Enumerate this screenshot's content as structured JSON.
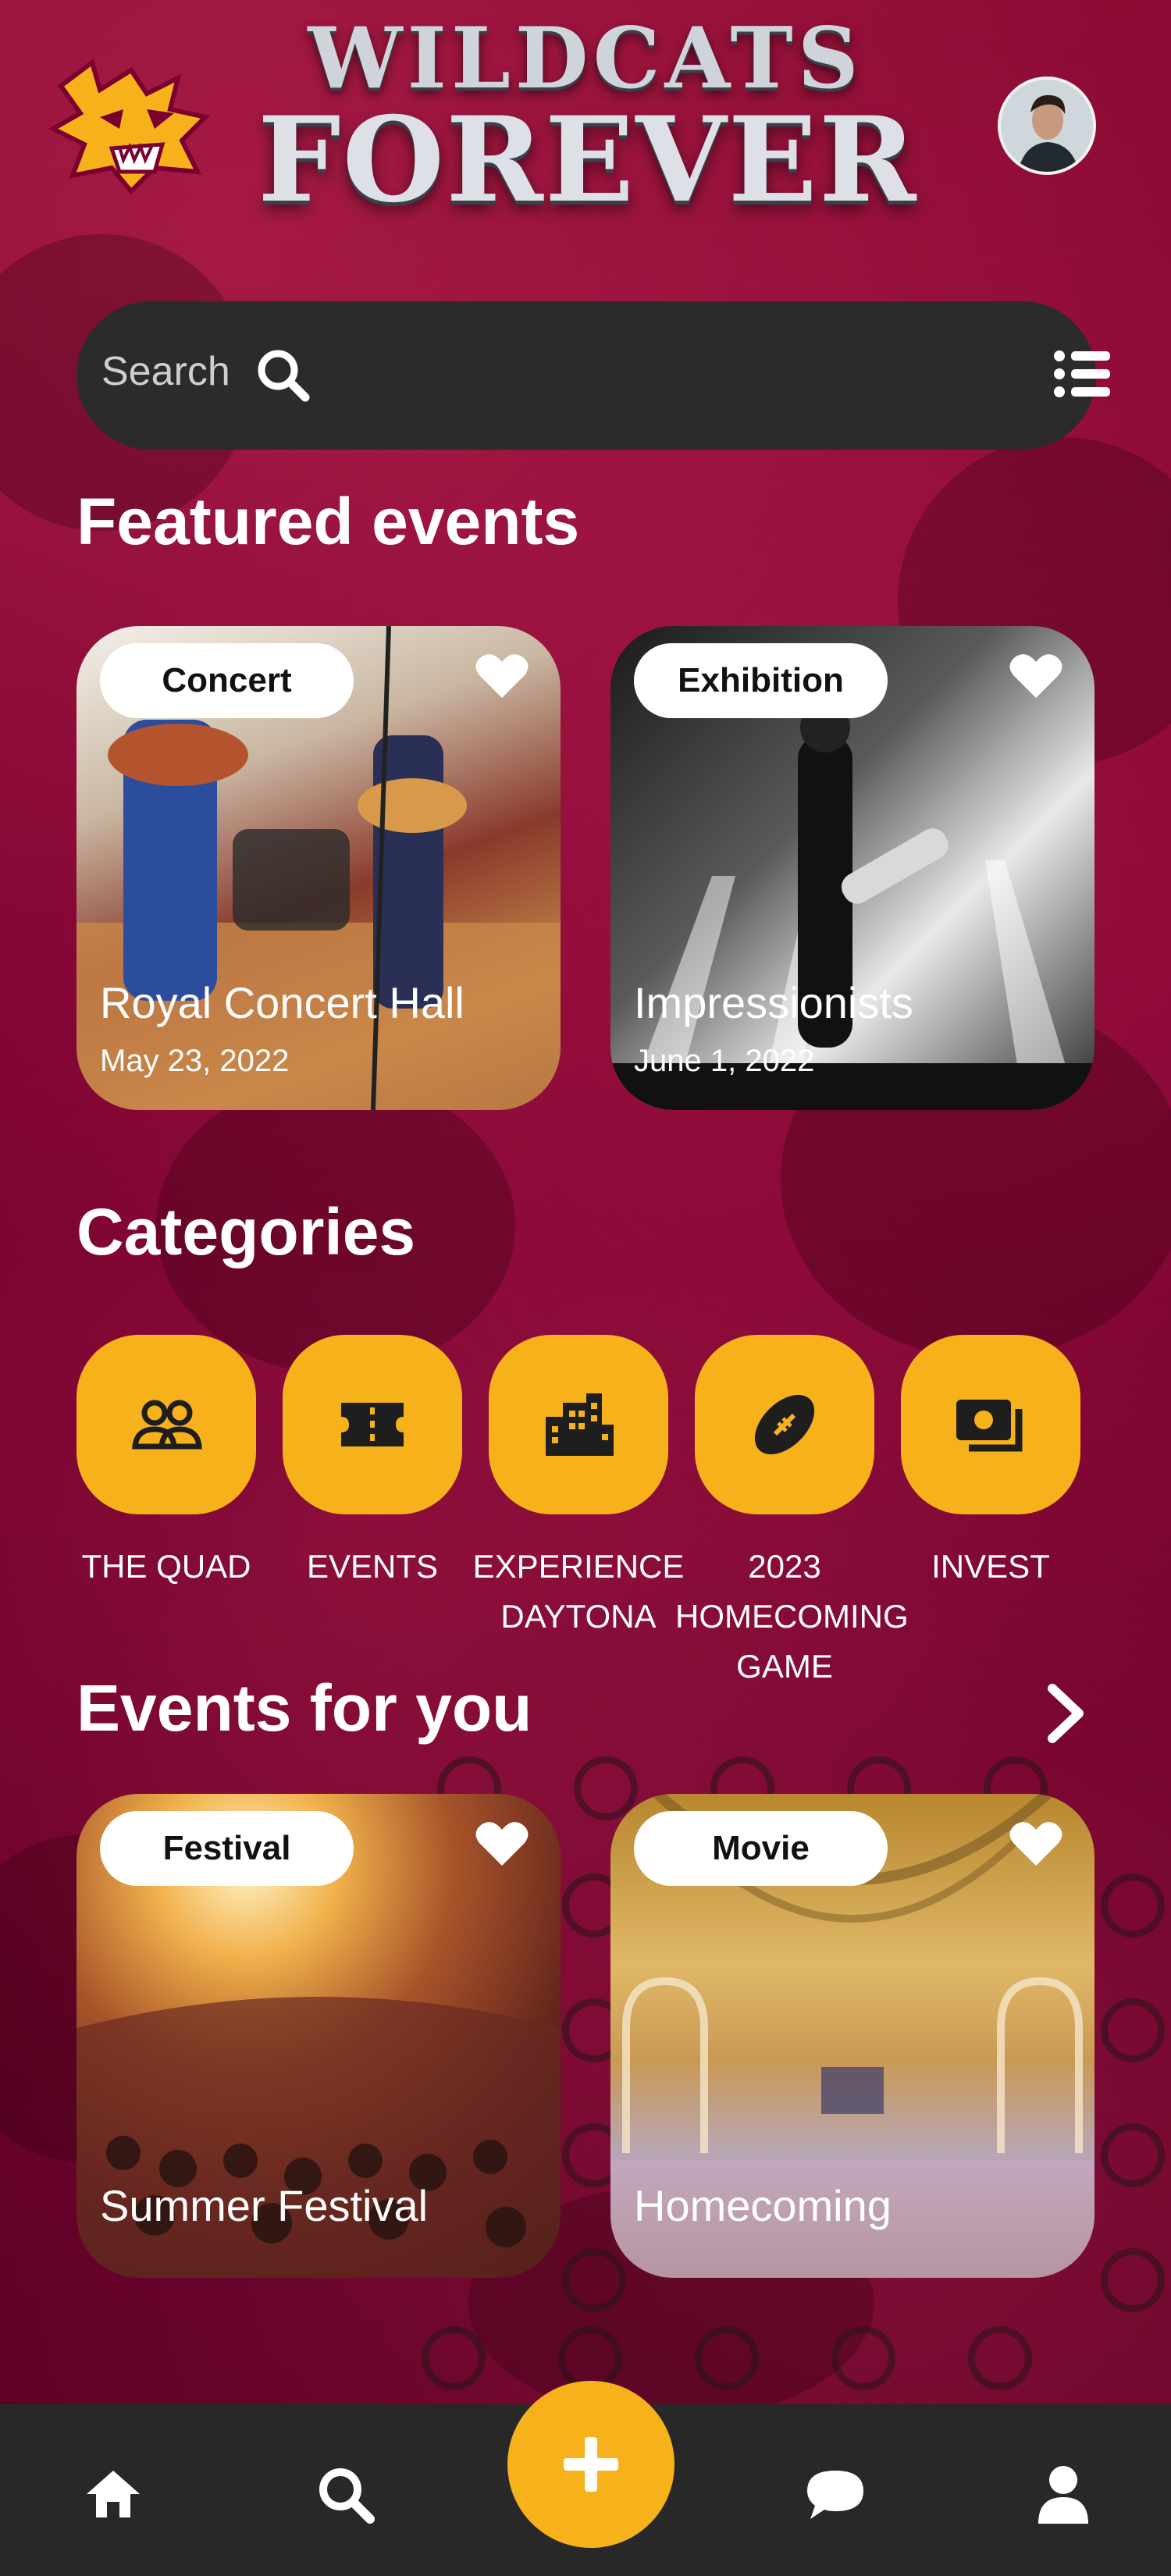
{
  "header": {
    "brand_line1": "WILDCATS",
    "brand_line2": "FOREVER"
  },
  "search": {
    "placeholder": "Search"
  },
  "sections": {
    "featured_title": "Featured events",
    "categories_title": "Categories",
    "for_you_title": "Events for you"
  },
  "featured_events": [
    {
      "tag": "Concert",
      "title": "Royal Concert Hall",
      "date": "May 23, 2022"
    },
    {
      "tag": "Exhibition",
      "title": "Impressionists",
      "date": "June 1, 2022"
    }
  ],
  "categories": [
    {
      "label": "THE QUAD",
      "icon": "people-icon"
    },
    {
      "label": "EVENTS",
      "icon": "ticket-icon"
    },
    {
      "label": "EXPERIENCE DAYTONA",
      "icon": "city-icon"
    },
    {
      "label": "2023 HOMECOMING GAME",
      "icon": "football-icon"
    },
    {
      "label": "INVEST",
      "icon": "money-icon"
    }
  ],
  "events_for_you": [
    {
      "tag": "Festival",
      "title": "Summer Festival"
    },
    {
      "tag": "Movie",
      "title": "Homecoming"
    }
  ],
  "nav": {
    "items": [
      "home-icon",
      "search-icon",
      "add-icon",
      "chat-icon",
      "profile-icon"
    ]
  },
  "colors": {
    "accent": "#f7b21b",
    "background": "#7a0030",
    "surface": "#282828"
  }
}
